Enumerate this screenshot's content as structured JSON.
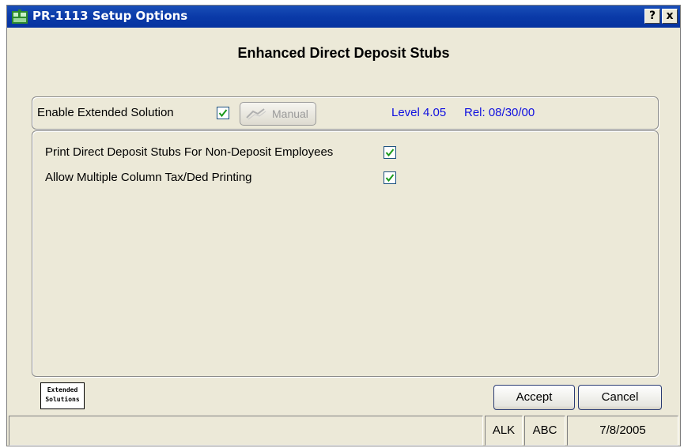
{
  "window": {
    "title": "PR-1113 Setup Options",
    "help_label": "?",
    "close_label": "x"
  },
  "heading": "Enhanced Direct Deposit Stubs",
  "extended": {
    "enable_label": "Enable Extended Solution",
    "enable_checked": true,
    "manual_label": "Manual",
    "level": "Level 4.05",
    "release": "Rel: 08/30/00"
  },
  "options": [
    {
      "label": "Print Direct Deposit Stubs For Non-Deposit Employees",
      "checked": true
    },
    {
      "label": "Allow Multiple Column Tax/Ded Printing",
      "checked": true
    }
  ],
  "logo": {
    "line1": "Extended",
    "line2": "Solutions"
  },
  "buttons": {
    "accept": "Accept",
    "cancel": "Cancel"
  },
  "statusbar": {
    "message": "",
    "user": "ALK",
    "company": "ABC",
    "date": "7/8/2005"
  },
  "colors": {
    "titlebar": "#0a3aa8",
    "info_text": "#1010e0",
    "checkmark": "#1a9a1a"
  }
}
